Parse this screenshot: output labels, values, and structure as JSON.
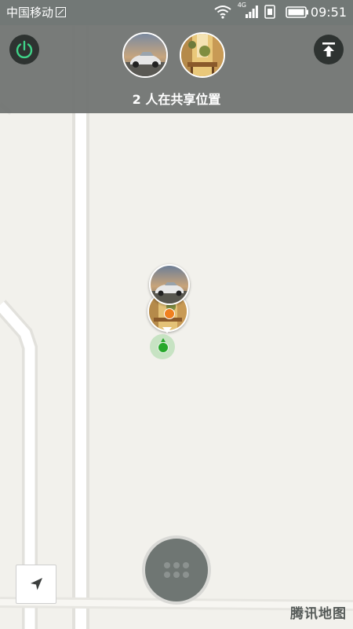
{
  "status_bar": {
    "carrier": "中国移动",
    "network": "4G",
    "time": "09:51"
  },
  "header": {
    "sharing_text": "2 人在共享位置",
    "participants": [
      {
        "avatar": "car-avatar"
      },
      {
        "avatar": "cafe-avatar"
      }
    ]
  },
  "map": {
    "logo": "腾讯地图",
    "colors": {
      "background": "#f2f1ec",
      "road": "#ffffff",
      "road_edge": "#e2e1dc",
      "overlay": "#727876",
      "my_location": "#27a82b",
      "friend_dot": "#f07f1f"
    }
  }
}
